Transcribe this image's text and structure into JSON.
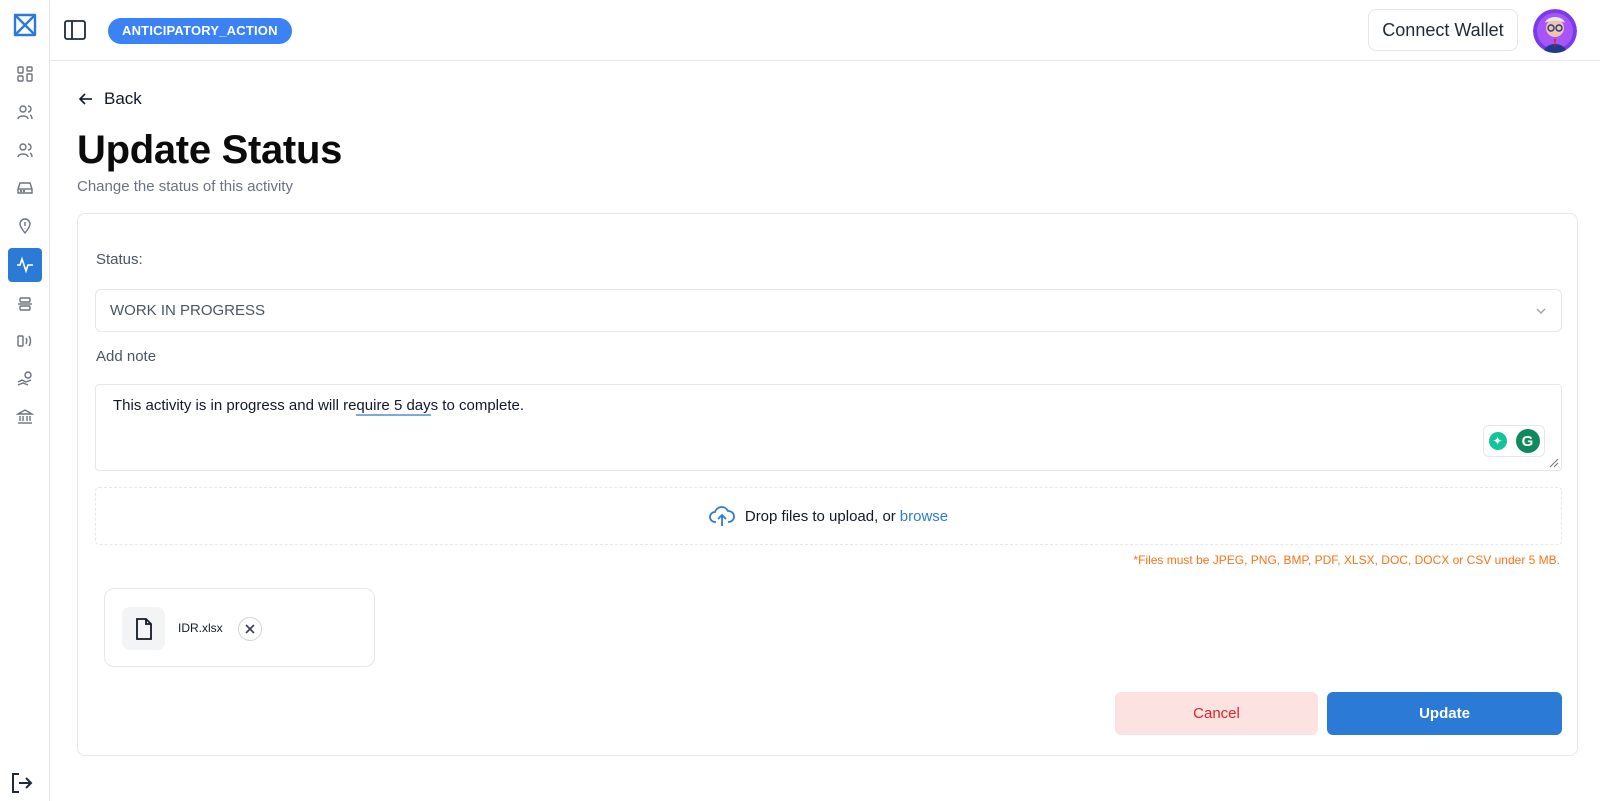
{
  "header": {
    "project_badge": "ANTICIPATORY_ACTION",
    "connect_wallet_label": "Connect Wallet"
  },
  "sidebar": {
    "items": [
      {
        "icon": "dashboard-icon"
      },
      {
        "icon": "users-icon"
      },
      {
        "icon": "group-icon"
      },
      {
        "icon": "inbox-icon"
      },
      {
        "icon": "location-pin-icon"
      },
      {
        "icon": "activity-icon",
        "active": true
      },
      {
        "icon": "align-center-icon"
      },
      {
        "icon": "signal-icon"
      },
      {
        "icon": "hand-coin-icon"
      },
      {
        "icon": "bank-icon"
      }
    ],
    "logout_icon": "logout-icon"
  },
  "page": {
    "back_label": "Back",
    "title": "Update Status",
    "subtitle": "Change the status of this activity"
  },
  "form": {
    "status_label": "Status:",
    "status_value": "WORK IN PROGRESS",
    "note_label": "Add note",
    "note_text_before": "This activity is in progress and will re",
    "note_text_underlined": "quire 5 day",
    "note_text_after": "s to complete.",
    "dropzone_text": "Drop files to upload, or",
    "dropzone_browse": "browse",
    "file_hint": "*Files must be JPEG, PNG, BMP, PDF, XLSX, DOC, DOCX or CSV under 5 MB."
  },
  "files": [
    {
      "name": "IDR.xlsx"
    }
  ],
  "actions": {
    "cancel_label": "Cancel",
    "update_label": "Update"
  },
  "colors": {
    "accent": "#2b7bd6",
    "badge": "#3b82f6",
    "cancel_bg": "#fde2e2",
    "cancel_text": "#dc2626",
    "hint": "#f97316"
  }
}
